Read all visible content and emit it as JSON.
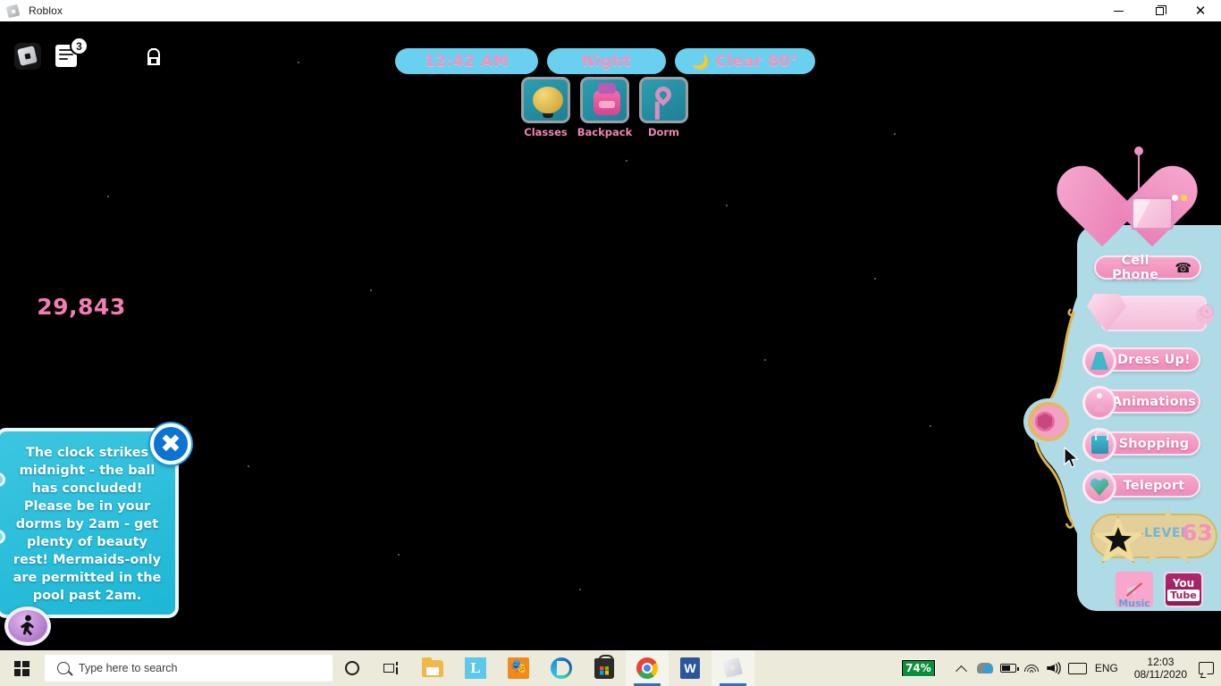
{
  "window": {
    "title": "Roblox",
    "icon": "roblox-logo-icon",
    "controls": {
      "minimize": "minimize-icon",
      "maximize": "restore-icon",
      "close": "close-icon"
    }
  },
  "roblox_topbar": {
    "logo_button": "roblox-menu-icon",
    "chat_button": "chat-icon",
    "chat_badge": "3",
    "backpack_button": "backpack-icon"
  },
  "status_pills": [
    {
      "name": "time",
      "label": "12:42 AM",
      "icon": ""
    },
    {
      "name": "daynight",
      "label": "Night",
      "icon": ""
    },
    {
      "name": "weather",
      "label": "Clear 80°",
      "icon": "🌙"
    }
  ],
  "hotbar": [
    {
      "label": "Classes",
      "icon": "bell-icon"
    },
    {
      "label": "Backpack",
      "icon": "backpack-bag-icon"
    },
    {
      "label": "Dorm",
      "icon": "heart-key-icon"
    }
  ],
  "dialog": {
    "text": "The clock strikes midnight - the ball has concluded! Please be in your dorms by 2am - get plenty of beauty rest! Mermaids-only are permitted in the pool past 2am.",
    "close_label": "✖"
  },
  "walk_toggle": {
    "icon": "walking-person-icon"
  },
  "right_panel": {
    "phone": {
      "icon": "heart-phone-icon"
    },
    "cell_phone_button": {
      "label": "Cell Phone",
      "icon": "phone-handset-icon"
    },
    "currency": {
      "value": "29,843",
      "icon": "diamond-gem-icon",
      "chevron": "‹"
    },
    "menu_buttons": [
      {
        "label": "Dress Up!",
        "icon": "dress-icon"
      },
      {
        "label": "Animations",
        "icon": "ballerina-icon"
      },
      {
        "label": "Shopping",
        "icon": "shopping-bag-icon"
      },
      {
        "label": "Teleport",
        "icon": "globe-heart-icon"
      }
    ],
    "level": {
      "word": "LEVEL",
      "number": "63",
      "icon": "gold-star-icon"
    },
    "music_button": {
      "label": "Music",
      "icon": "speaker-muted-icon"
    },
    "youtube_button": {
      "line1": "You",
      "line2": "Tube",
      "icon": "youtube-icon"
    },
    "side_tab": {
      "icon": "pink-gem-tab-icon"
    }
  },
  "taskbar": {
    "start": "windows-start-icon",
    "search": {
      "placeholder": "Type here to search",
      "icon": "search-icon"
    },
    "cortana": "cortana-icon",
    "task_view": "task-view-icon",
    "apps": [
      {
        "name": "file-explorer",
        "icon": "folder-icon",
        "active": false
      },
      {
        "name": "app-l",
        "icon": "letter-l-icon",
        "active": false
      },
      {
        "name": "app-orange",
        "icon": "orange-app-icon",
        "active": false
      },
      {
        "name": "microsoft-edge",
        "icon": "edge-icon",
        "active": false
      },
      {
        "name": "microsoft-store",
        "icon": "store-icon",
        "active": false
      },
      {
        "name": "google-chrome",
        "icon": "chrome-icon",
        "active": true
      },
      {
        "name": "microsoft-word",
        "icon": "word-icon",
        "active": false
      },
      {
        "name": "roblox",
        "icon": "roblox-icon",
        "active": true
      }
    ],
    "tray": {
      "battery_percent": "74%",
      "show_hidden": "chevron-up-icon",
      "onedrive": "onedrive-icon",
      "battery": "battery-icon",
      "wifi": "wifi-icon",
      "volume": "volume-icon",
      "keyboard": "keyboard-icon",
      "language": "ENG",
      "clock_time": "12:03",
      "clock_date": "08/11/2020",
      "action_center": "notification-icon"
    }
  },
  "colors": {
    "pill_bg": "#6ad0ef",
    "pill_text": "#f58fbb",
    "panel_bg": "#aedbe6",
    "button_pink": "#ef8cba",
    "dialog_bg": "#1cb7d6",
    "taskbar_bg": "#eceadb",
    "battery_green": "#0a8f3c"
  }
}
